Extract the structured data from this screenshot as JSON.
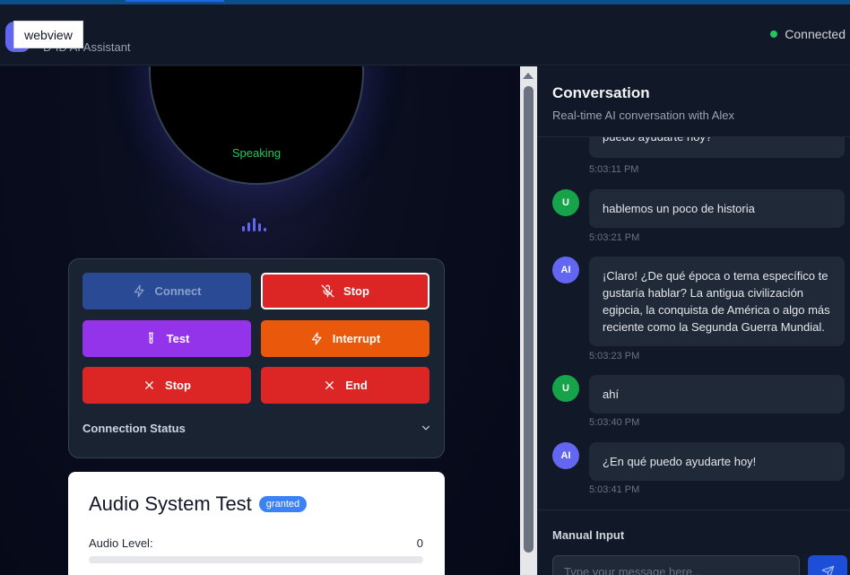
{
  "header": {
    "webview_label": "webview",
    "subtitle": "D-ID AI Assistant",
    "connection_status": "Connected"
  },
  "avatar": {
    "status": "Speaking"
  },
  "controls": {
    "connect_label": "Connect",
    "stop_mic_label": "Stop",
    "test_label": "Test",
    "interrupt_label": "Interrupt",
    "stop_label": "Stop",
    "end_label": "End",
    "connection_status_label": "Connection Status"
  },
  "audio_test": {
    "title": "Audio System Test",
    "badge": "granted",
    "level_label": "Audio Level:",
    "level_value": "0"
  },
  "conversation": {
    "title": "Conversation",
    "subtitle": "Real-time AI conversation with Alex",
    "messages": [
      {
        "role": "AI",
        "text": "puedo ayudarte hoy?",
        "time": "5:03:11 PM"
      },
      {
        "role": "U",
        "text": "hablemos un poco de historia",
        "time": "5:03:21 PM"
      },
      {
        "role": "AI",
        "text": "¡Claro! ¿De qué época o tema específico te gustaría hablar? La antigua civilización egipcia, la conquista de América o algo más reciente como la Segunda Guerra Mundial.",
        "time": "5:03:23 PM"
      },
      {
        "role": "U",
        "text": "ahí",
        "time": "5:03:40 PM"
      },
      {
        "role": "AI",
        "text": "¿En qué puedo ayudarte hoy!",
        "time": "5:03:41 PM"
      }
    ],
    "manual_input_label": "Manual Input",
    "input_placeholder": "Type your message here..."
  },
  "colors": {
    "connected": "#22c55e",
    "user_avatar": "#16a34a",
    "ai_avatar": "#6366f1",
    "stop": "#dc2626",
    "test": "#9333ea",
    "interrupt": "#ea580c",
    "connect": "#2b4a96"
  },
  "icons": {
    "connect": "zap-icon",
    "stop_mic": "mic-off-icon",
    "test": "test-tube-icon",
    "interrupt": "zap-icon",
    "stop": "x-icon",
    "end": "x-icon",
    "expand": "chevron-down-icon",
    "send": "send-icon"
  }
}
